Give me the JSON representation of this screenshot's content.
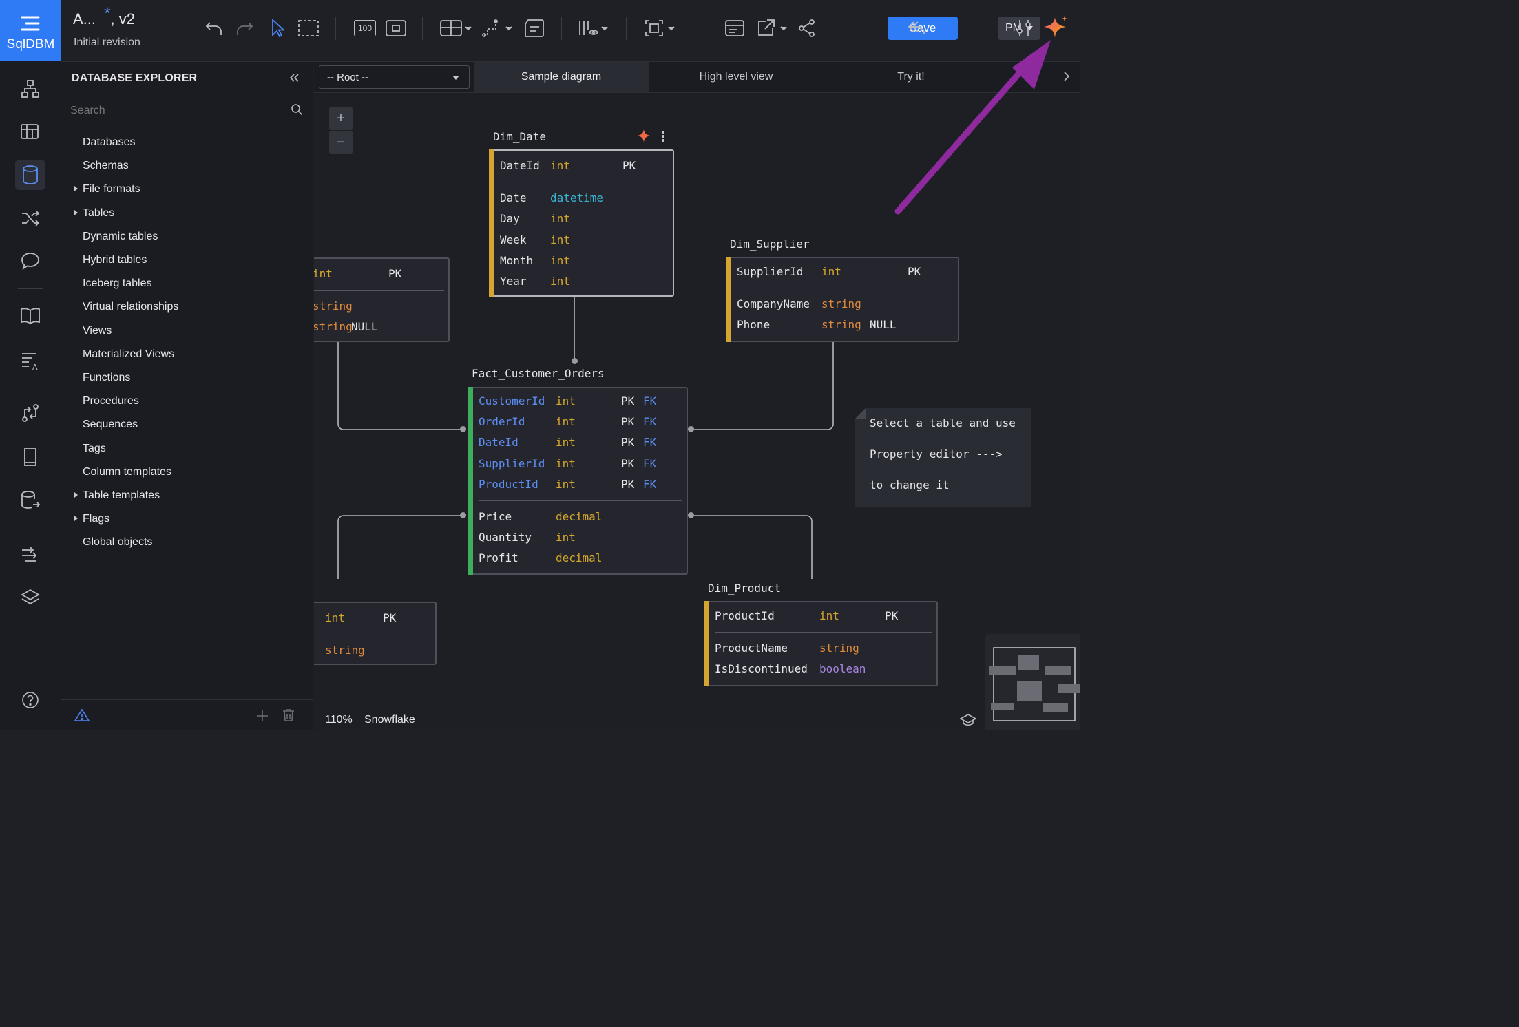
{
  "app": {
    "logo_text": "SqlDBM",
    "title": "A...",
    "modified_mark": "*",
    "version": ", v2",
    "subtitle": "Initial revision"
  },
  "toolbar": {
    "zoom_preset": "100",
    "save_label": "Save",
    "user_initials": "PM"
  },
  "rail": {
    "items": [
      "diagram-icon",
      "tables-grid-icon",
      "database-icon",
      "shuffle-icon",
      "comment-icon",
      "book-icon",
      "text-format-icon",
      "compare-icon",
      "document-icon",
      "database-export-icon",
      "import-export-icon",
      "layers-icon"
    ],
    "help": "help-icon"
  },
  "explorer": {
    "title": "DATABASE EXPLORER",
    "search_placeholder": "Search",
    "items": [
      {
        "label": "Databases",
        "expandable": false
      },
      {
        "label": "Schemas",
        "expandable": false
      },
      {
        "label": "File formats",
        "expandable": true
      },
      {
        "label": "Tables",
        "expandable": true
      },
      {
        "label": "Dynamic tables",
        "expandable": false
      },
      {
        "label": "Hybrid tables",
        "expandable": false
      },
      {
        "label": "Iceberg tables",
        "expandable": false
      },
      {
        "label": "Virtual relationships",
        "expandable": false
      },
      {
        "label": "Views",
        "expandable": false
      },
      {
        "label": "Materialized Views",
        "expandable": false
      },
      {
        "label": "Functions",
        "expandable": false
      },
      {
        "label": "Procedures",
        "expandable": false
      },
      {
        "label": "Sequences",
        "expandable": false
      },
      {
        "label": "Tags",
        "expandable": false
      },
      {
        "label": "Column templates",
        "expandable": false
      },
      {
        "label": "Table templates",
        "expandable": true
      },
      {
        "label": "Flags",
        "expandable": true
      },
      {
        "label": "Global objects",
        "expandable": false
      }
    ]
  },
  "tabs": {
    "root_select": "-- Root --",
    "items": [
      "Sample diagram",
      "High level view",
      "Try it!"
    ],
    "active": "Sample diagram"
  },
  "diagram": {
    "tables": {
      "dim_date": {
        "name": "Dim_Date",
        "rows": [
          [
            "DateId",
            "int",
            "PK",
            ""
          ],
          [
            "Date",
            "datetime",
            "",
            ""
          ],
          [
            "Day",
            "int",
            "",
            ""
          ],
          [
            "Week",
            "int",
            "",
            ""
          ],
          [
            "Month",
            "int",
            "",
            ""
          ],
          [
            "Year",
            "int",
            "",
            ""
          ]
        ]
      },
      "dim_supplier": {
        "name": "Dim_Supplier",
        "rows": [
          [
            "SupplierId",
            "int",
            "PK",
            ""
          ],
          [
            "CompanyName",
            "string",
            "",
            ""
          ],
          [
            "Phone",
            "string",
            "NULL",
            ""
          ]
        ]
      },
      "fact": {
        "name": "Fact_Customer_Orders",
        "rows": [
          [
            "CustomerId",
            "int",
            "PK",
            "FK"
          ],
          [
            "OrderId",
            "int",
            "PK",
            "FK"
          ],
          [
            "DateId",
            "int",
            "PK",
            "FK"
          ],
          [
            "SupplierId",
            "int",
            "PK",
            "FK"
          ],
          [
            "ProductId",
            "int",
            "PK",
            "FK"
          ],
          [
            "Price",
            "decimal",
            "",
            ""
          ],
          [
            "Quantity",
            "int",
            "",
            ""
          ],
          [
            "Profit",
            "decimal",
            "",
            ""
          ]
        ]
      },
      "dim_product": {
        "name": "Dim_Product",
        "rows": [
          [
            "ProductId",
            "int",
            "PK",
            ""
          ],
          [
            "ProductName",
            "string",
            "",
            ""
          ],
          [
            "IsDiscontinued",
            "boolean",
            "",
            ""
          ]
        ]
      },
      "left_top": {
        "rows": [
          [
            "int",
            "PK"
          ],
          [
            "string",
            ""
          ],
          [
            "string",
            "NULL"
          ]
        ]
      },
      "left_bottom": {
        "rows": [
          [
            "int",
            "PK"
          ],
          [
            "string",
            ""
          ]
        ]
      }
    },
    "note": [
      "Select a table and use",
      "Property editor --->",
      "to change it"
    ]
  },
  "status": {
    "zoom": "110%",
    "platform": "Snowflake"
  },
  "colors": {
    "accent": "#2f7bf5",
    "annotation_arrow": "#8e2a9e",
    "fact_bar": "#3fae5c",
    "dim_bar": "#d6a531"
  }
}
